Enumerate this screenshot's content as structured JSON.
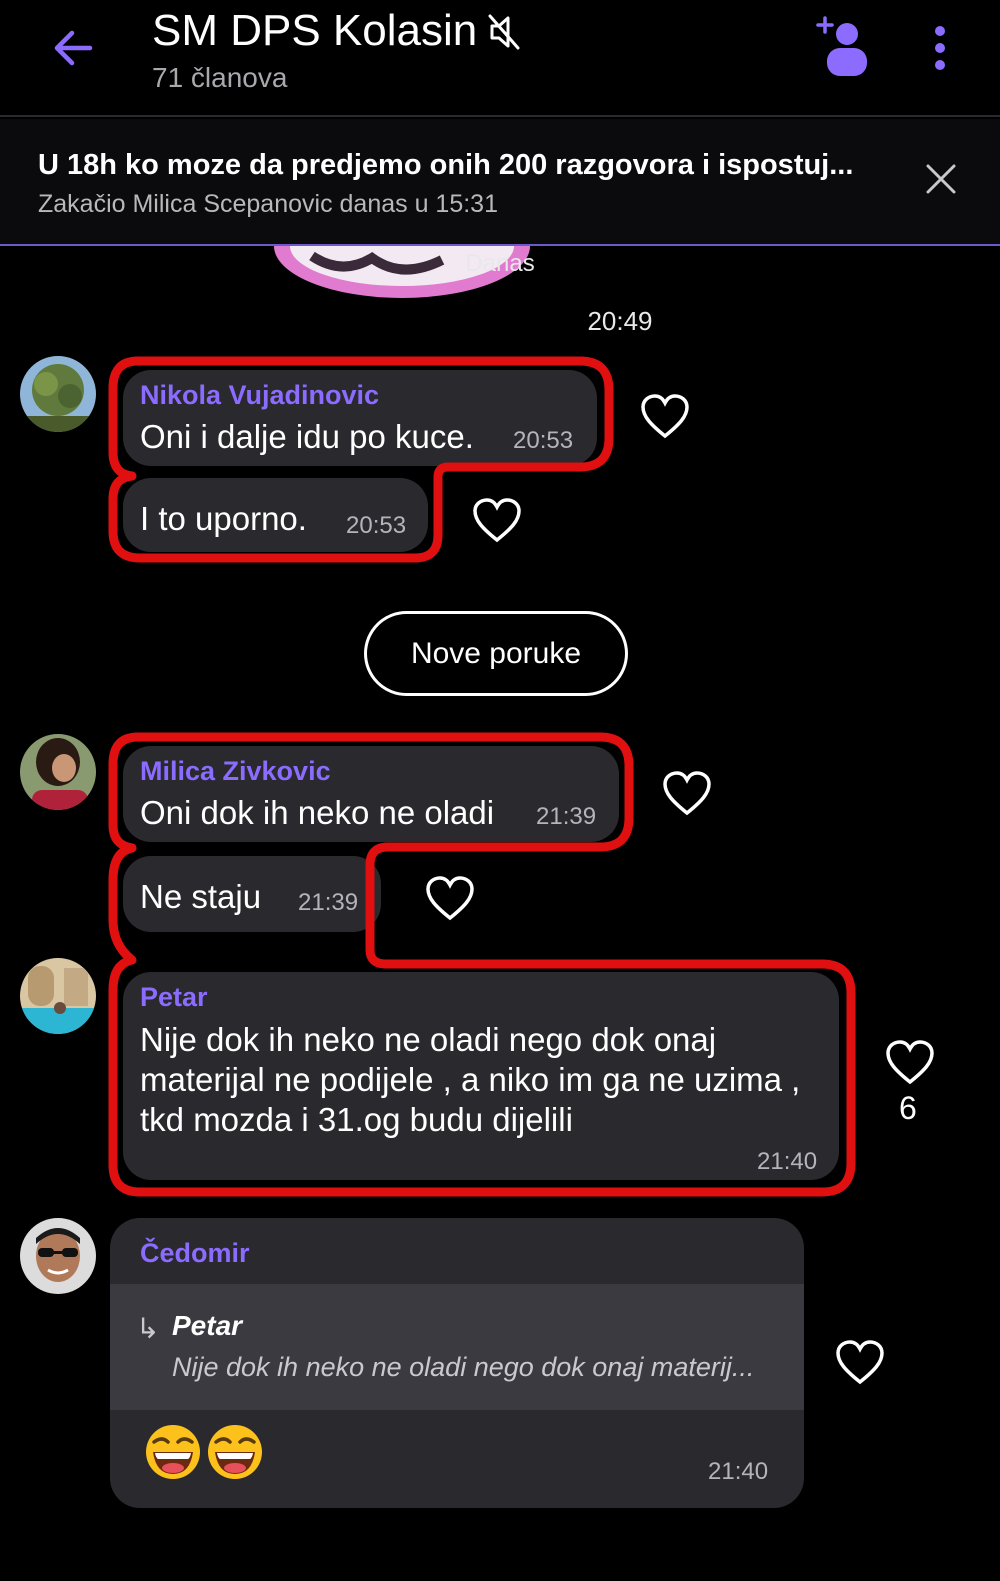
{
  "header": {
    "title": "SM DPS Kolasin",
    "subtitle": "71 članova",
    "icons": [
      "back-arrow-icon",
      "mute-icon",
      "add-member-icon",
      "more-icon"
    ],
    "accent": "#8b6cff"
  },
  "pinned": {
    "title": "U 18h ko moze da predjemo onih 200 razgovora i ispostuj...",
    "meta": "Zakačio Milica Scepanovic danas u 15:31"
  },
  "day_label": "Danas",
  "first_time": "20:49",
  "messages": [
    {
      "sender": "Nikola Vujadinovic",
      "text": "Oni i dalje idu po kuce.",
      "time": "20:53"
    },
    {
      "text": "I to uporno.",
      "time": "20:53"
    },
    {
      "sender": "Milica Zivkovic",
      "text": "Oni dok ih neko ne oladi",
      "time": "21:39"
    },
    {
      "text": "Ne staju",
      "time": "21:39"
    },
    {
      "sender": "Petar",
      "lines": [
        "Nije dok ih neko ne oladi nego dok onaj",
        "materijal ne podijele , a niko im ga ne uzima ,",
        "tkd mozda i 31.og budu dijelili"
      ],
      "time": "21:40",
      "likes": "6"
    },
    {
      "sender": "Čedomir",
      "reply_to": {
        "name": "Petar",
        "text": "Nije dok ih neko ne oladi nego dok onaj materij..."
      },
      "time": "21:40",
      "emojis": [
        "laughing-emoji",
        "laughing-emoji"
      ]
    }
  ],
  "new_messages_button": "Nove poruke",
  "highlight_color": "#e01010",
  "bubble_color": "#29292e"
}
